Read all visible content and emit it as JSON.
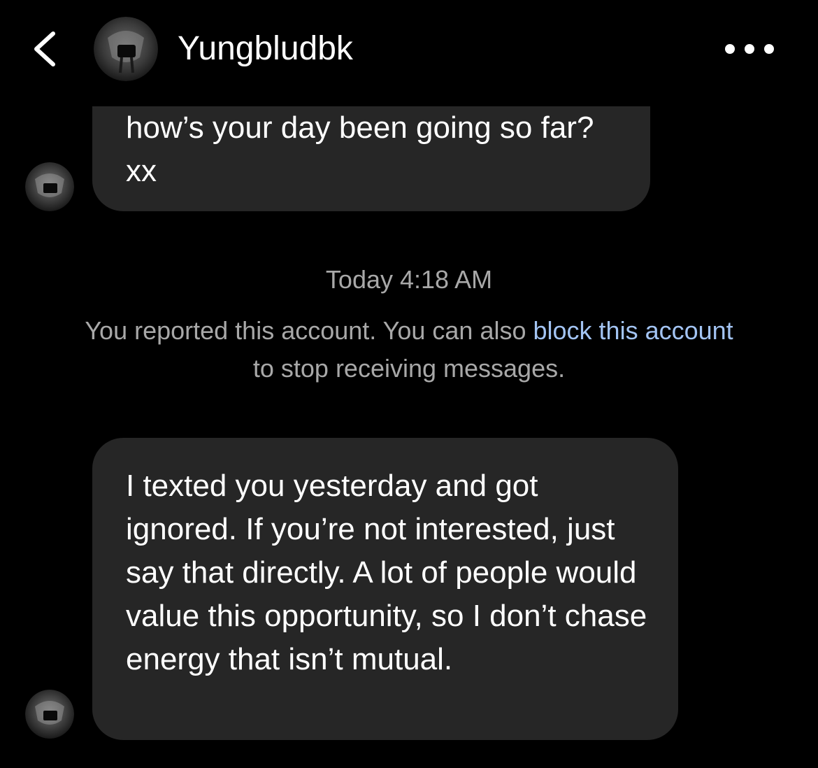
{
  "header": {
    "back_icon": "chevron-left-icon",
    "username": "Yungbludbk",
    "more_icon": "ellipsis-horizontal-icon"
  },
  "messages": [
    {
      "text": "how’s your day been going so far? xx"
    },
    {
      "text": "I texted you yesterday and got ignored. If you’re not interested, just say that directly. A lot of people would value this opportunity, so I don’t chase energy that isn’t mutual."
    }
  ],
  "timestamp": "Today 4:18 AM",
  "report_notice": {
    "before": "You reported this account. You can also ",
    "link": "block this account",
    "after": " to stop receiving messages."
  },
  "colors": {
    "background": "#000000",
    "bubble": "#262626",
    "secondary_text": "#a8a8a8",
    "link": "#a3c4f3"
  }
}
